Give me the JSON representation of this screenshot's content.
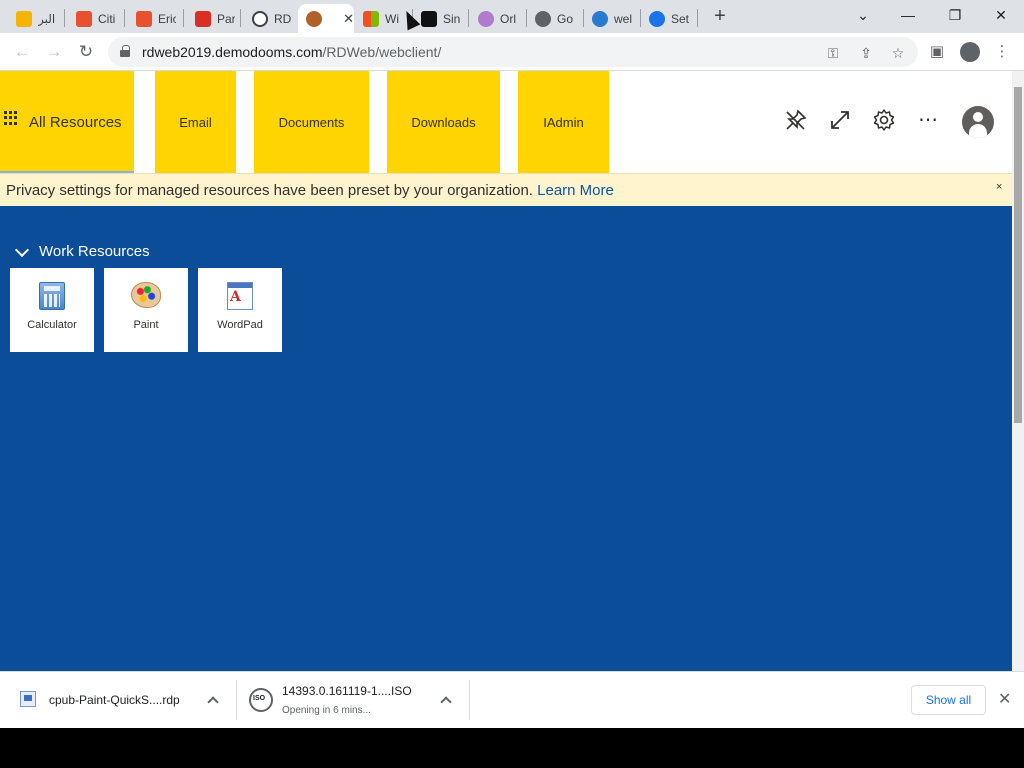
{
  "browser": {
    "tabs": [
      {
        "title": "البر",
        "favicon_color": "#f4b400"
      },
      {
        "title": "Citi",
        "favicon_color": "#e8502e"
      },
      {
        "title": "Eric",
        "favicon_color": "#e8502e"
      },
      {
        "title": "Par",
        "favicon_color": "#d93025"
      },
      {
        "title": "RD",
        "favicon_color": "#3c4043"
      },
      {
        "title": "",
        "favicon_color": "#b0602a"
      },
      {
        "title": "Wi",
        "favicon_color": "#0078d4"
      },
      {
        "title": "Sin",
        "favicon_color": "#111111"
      },
      {
        "title": "Orl",
        "favicon_color": "#b07ad0"
      },
      {
        "title": "Go",
        "favicon_color": "#5f6368"
      },
      {
        "title": "wel",
        "favicon_color": "#2a7ad0"
      },
      {
        "title": "Set",
        "favicon_color": "#1a73e8"
      }
    ],
    "active_tab_close": "✕",
    "new_tab": "+",
    "window_controls": {
      "tab_search": "⌄",
      "minimize": "—",
      "restore": "❐",
      "close": "✕"
    },
    "url_host": "rdweb2019.demodooms.com",
    "url_path": "/RDWeb/webclient/",
    "toolbar_icons": [
      "key-icon",
      "share-icon",
      "star-icon",
      "side-panel-icon",
      "profile-icon",
      "menu-icon"
    ]
  },
  "rdweb": {
    "nav_tabs": [
      {
        "label": "All Resources"
      },
      {
        "label": "Email"
      },
      {
        "label": "Documents"
      },
      {
        "label": "Downloads"
      },
      {
        "label": "IAdmin"
      }
    ],
    "header_icons": [
      "unpin-icon",
      "fullscreen-icon",
      "settings-icon",
      "more-icon",
      "avatar-icon"
    ],
    "banner": {
      "text": "Privacy settings for managed resources have been preset by your organization.",
      "link": "Learn More",
      "close": "×"
    },
    "section": {
      "title": "Work Resources",
      "apps": [
        {
          "label": "Calculator"
        },
        {
          "label": "Paint"
        },
        {
          "label": "WordPad"
        }
      ]
    }
  },
  "downloads": {
    "items": [
      {
        "name": "cpub-Paint-QuickS....rdp",
        "status": ""
      },
      {
        "name": "14393.0.161119-1....ISO",
        "status": "Opening in 6 mins..."
      }
    ],
    "show_all": "Show all",
    "close": "✕"
  }
}
